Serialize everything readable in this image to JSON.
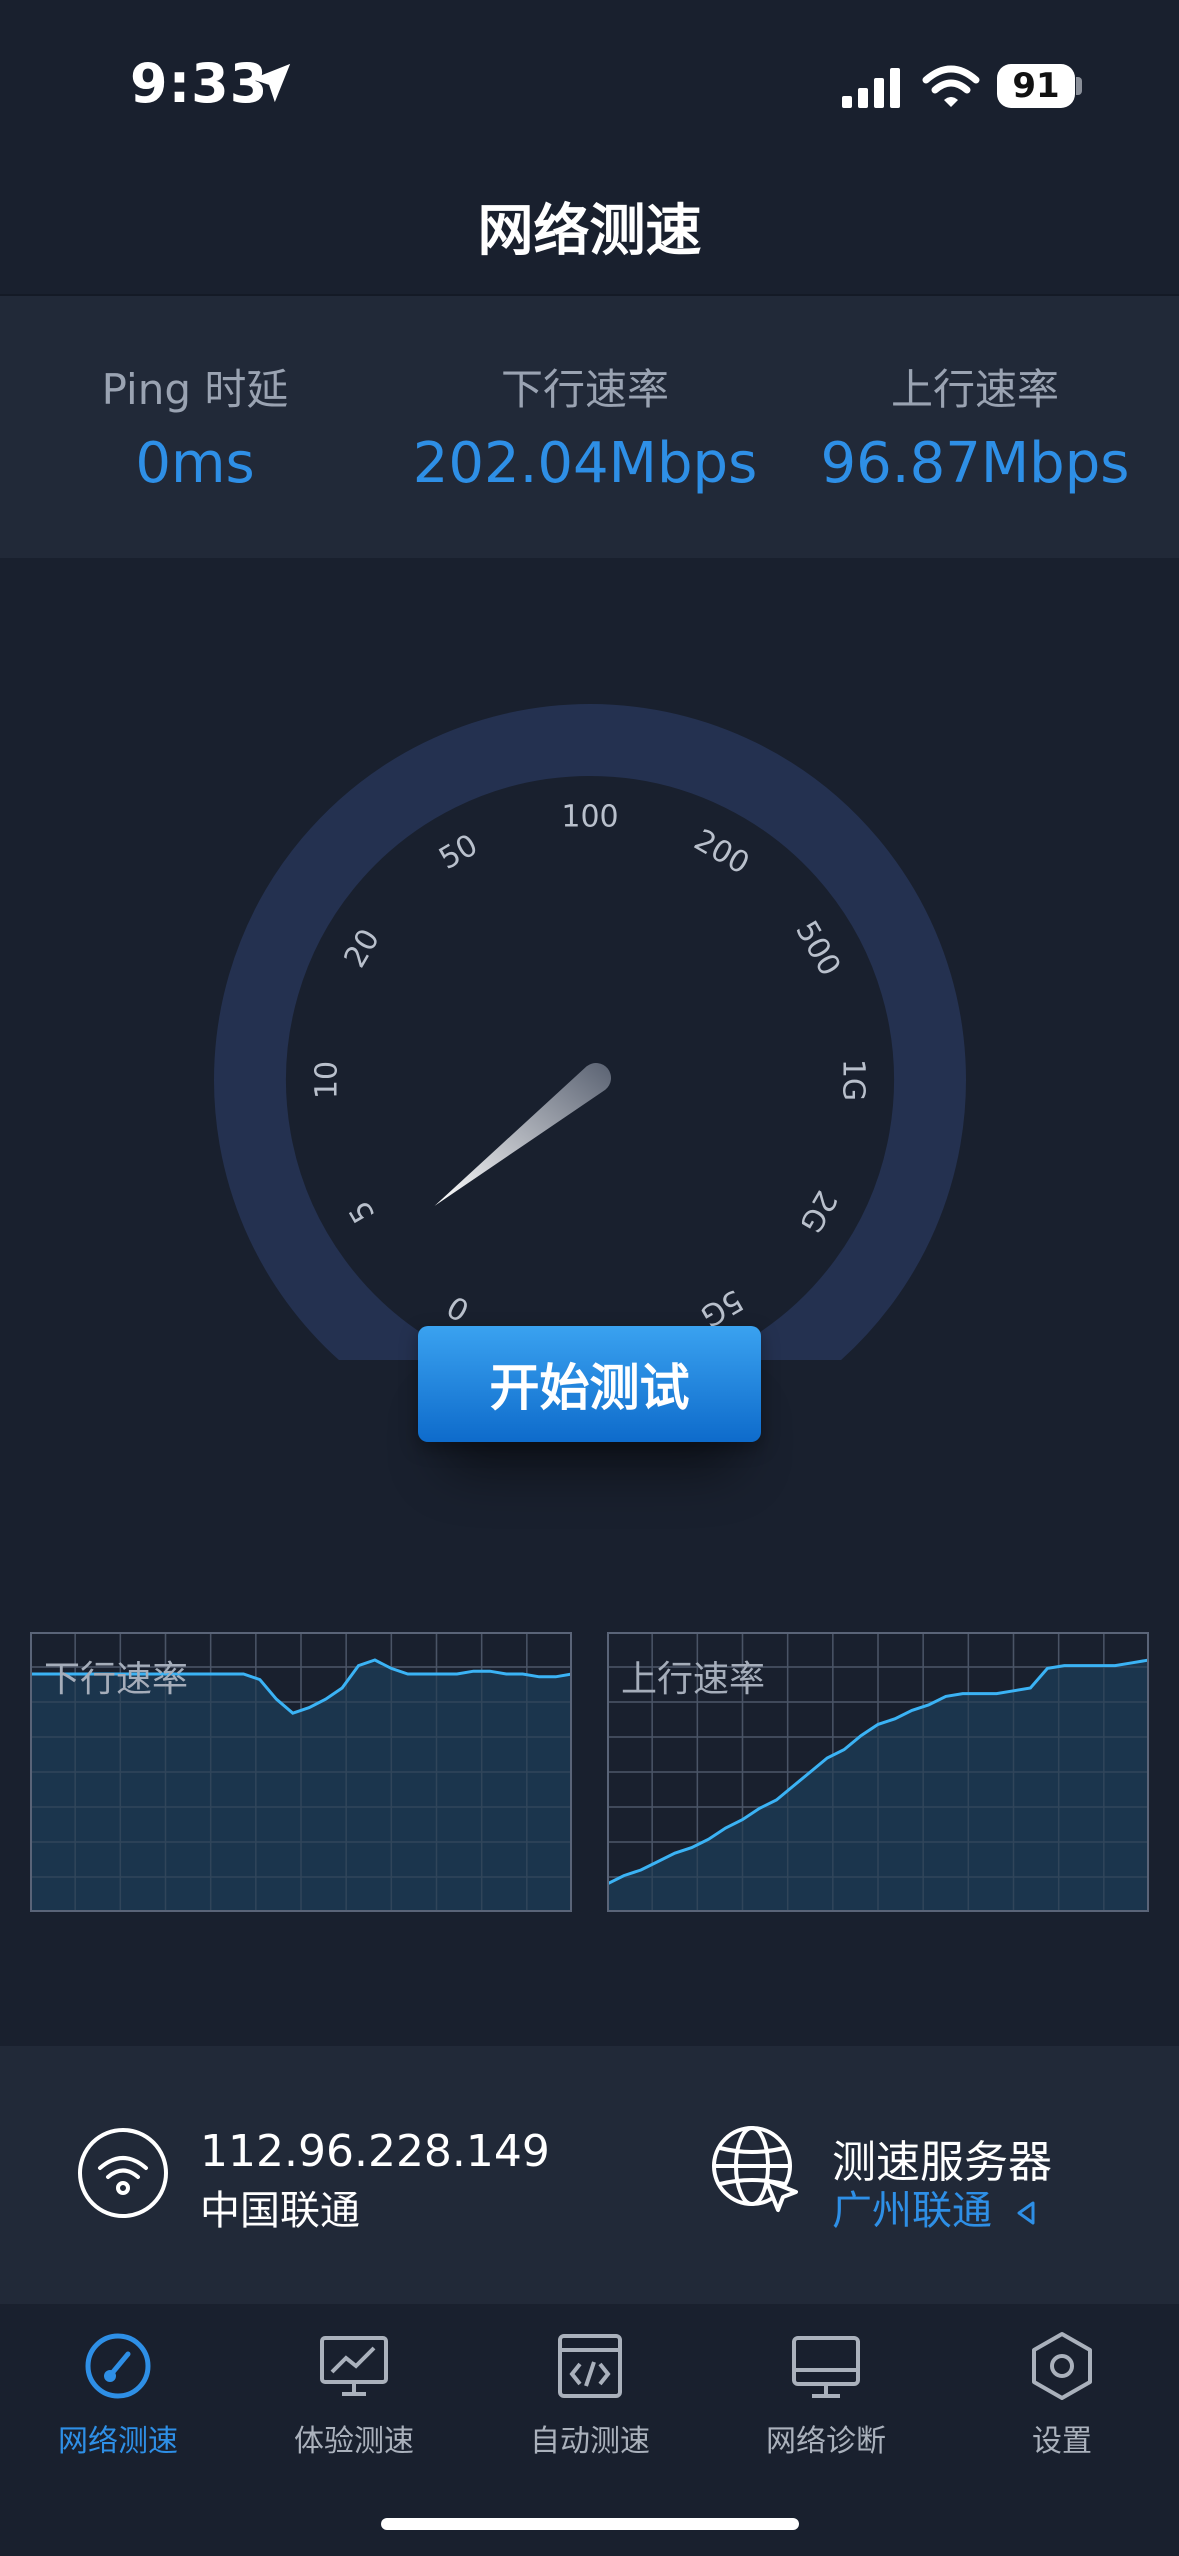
{
  "status_bar": {
    "time": "9:33",
    "battery": "91"
  },
  "nav": {
    "title": "网络测速"
  },
  "stats": [
    {
      "label": "Ping 时延",
      "value": "0ms"
    },
    {
      "label": "下行速率",
      "value": "202.04Mbps"
    },
    {
      "label": "上行速率",
      "value": "96.87Mbps"
    }
  ],
  "gauge": {
    "ticks": [
      "0",
      "5",
      "10",
      "20",
      "50",
      "100",
      "200",
      "500",
      "1G",
      "2G",
      "5G"
    ],
    "needle_value_fraction": 0.07
  },
  "start_button": {
    "label": "开始测试"
  },
  "charts": {
    "download": {
      "label": "下行速率",
      "levels": [
        0.85,
        0.85,
        0.85,
        0.85,
        0.85,
        0.85,
        0.85,
        0.85,
        0.85,
        0.85,
        0.85,
        0.85,
        0.85,
        0.85,
        0.83,
        0.76,
        0.71,
        0.73,
        0.76,
        0.8,
        0.88,
        0.9,
        0.87,
        0.85,
        0.85,
        0.85,
        0.85,
        0.86,
        0.86,
        0.85,
        0.85,
        0.84,
        0.84,
        0.85
      ]
    },
    "upload": {
      "label": "上行速率",
      "levels": [
        0.1,
        0.13,
        0.15,
        0.18,
        0.21,
        0.23,
        0.26,
        0.3,
        0.33,
        0.37,
        0.4,
        0.45,
        0.5,
        0.55,
        0.58,
        0.63,
        0.67,
        0.69,
        0.72,
        0.74,
        0.77,
        0.78,
        0.78,
        0.78,
        0.79,
        0.8,
        0.87,
        0.88,
        0.88,
        0.88,
        0.88,
        0.89,
        0.9
      ]
    },
    "colors": {
      "line": "#3BB3F5",
      "fill": "#1C3A52",
      "grid": "#4A5466",
      "frame": "#5A6478"
    }
  },
  "info": {
    "ip": "112.96.228.149",
    "isp": "中国联通",
    "server_title": "测速服务器",
    "server_name": "广州联通"
  },
  "tabs": [
    {
      "label": "网络测速",
      "icon": "speedometer-icon",
      "active": true
    },
    {
      "label": "体验测速",
      "icon": "chart-monitor-icon",
      "active": false
    },
    {
      "label": "自动测速",
      "icon": "code-window-icon",
      "active": false
    },
    {
      "label": "网络诊断",
      "icon": "monitor-icon",
      "active": false
    },
    {
      "label": "设置",
      "icon": "settings-hexagon-icon",
      "active": false
    }
  ],
  "colors": {
    "accent": "#2E8FE6",
    "background": "#19202E",
    "panel": "#212938",
    "gauge_arc": "#243150"
  }
}
